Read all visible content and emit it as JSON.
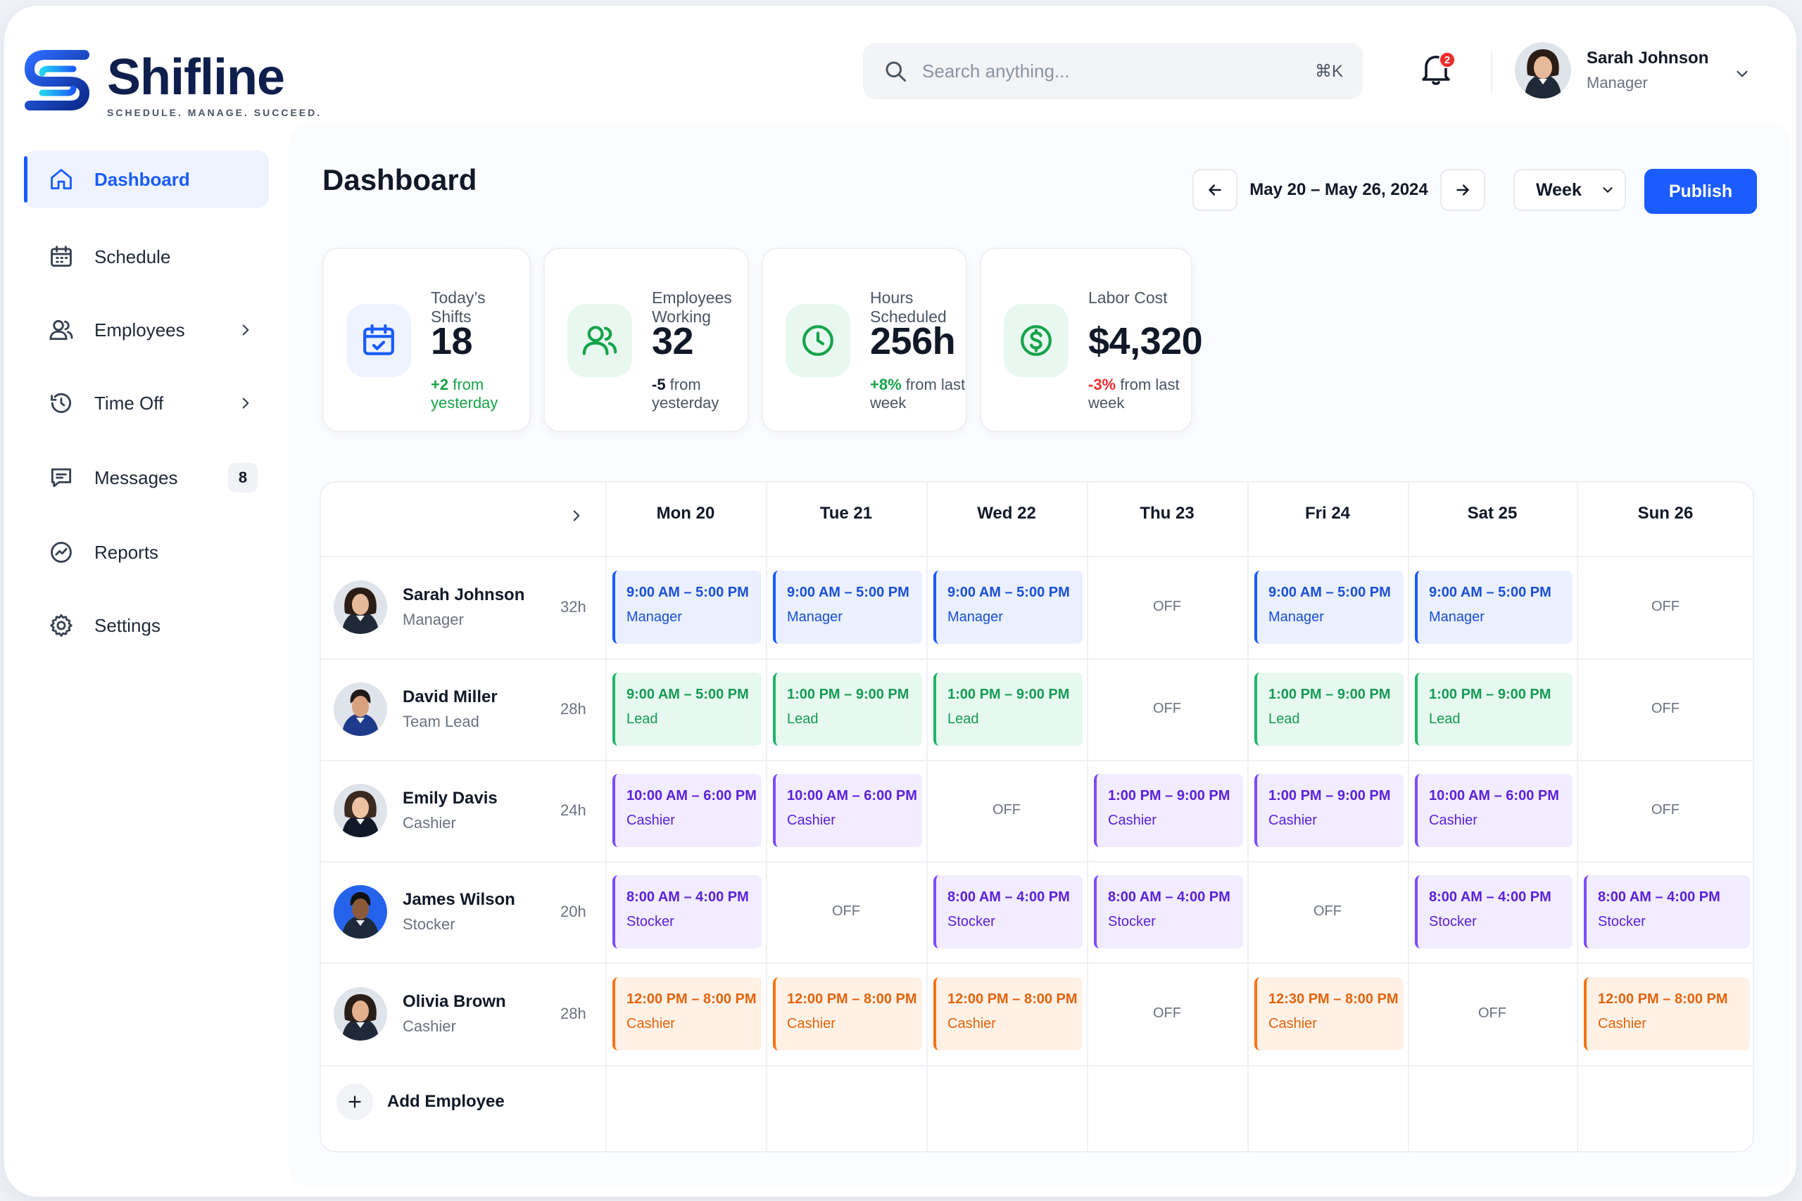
{
  "brand": {
    "name": "Shifline",
    "tagline": "SCHEDULE. MANAGE. SUCCEED."
  },
  "search": {
    "placeholder": "Search anything...",
    "shortcut": "⌘K"
  },
  "notifications": {
    "count": "2"
  },
  "user": {
    "name": "Sarah Johnson",
    "role": "Manager"
  },
  "sidebar": {
    "items": [
      {
        "label": "Dashboard",
        "icon": "home-icon",
        "active": true
      },
      {
        "label": "Schedule",
        "icon": "calendar-icon"
      },
      {
        "label": "Employees",
        "icon": "users-icon",
        "chevron": true
      },
      {
        "label": "Time Off",
        "icon": "clock-icon",
        "chevron": true
      },
      {
        "label": "Messages",
        "icon": "chat-icon",
        "badge": "8"
      },
      {
        "label": "Reports",
        "icon": "chart-icon"
      },
      {
        "label": "Settings",
        "icon": "gear-icon"
      }
    ]
  },
  "page": {
    "title": "Dashboard"
  },
  "toolbar": {
    "date_range": "May 20 – May 26, 2024",
    "view": "Week",
    "publish_label": "Publish"
  },
  "stats": [
    {
      "label": "Today’s Shifts",
      "value": "18",
      "change": "+2",
      "suffix": " from yesterday",
      "change_color": "#16a34a",
      "icon": "calendar-icon"
    },
    {
      "label": "Employees Working",
      "value": "32",
      "change": "-5",
      "suffix": " from yesterday",
      "change_color": "#111827",
      "icon": "users-icon"
    },
    {
      "label": "Hours Scheduled",
      "value": "256h",
      "change": "+8%",
      "suffix": " from last week",
      "change_color": "#16a34a",
      "icon": "clock-icon"
    },
    {
      "label": "Labor Cost",
      "value": "$4,320",
      "change": "-3%",
      "suffix": " from last week",
      "change_color": "#ef2b2b",
      "icon": "dollar-icon"
    }
  ],
  "schedule": {
    "days": [
      "Mon 20",
      "Tue 21",
      "Wed 22",
      "Thu 23",
      "Fri 24",
      "Sat 25",
      "Sun 26"
    ],
    "off_label": "OFF",
    "employees": [
      {
        "name": "Sarah Johnson",
        "role": "Manager",
        "hours": "32h",
        "shifts": [
          {
            "time": "9:00 AM – 5:00 PM",
            "role": "Manager",
            "color": "blue"
          },
          {
            "time": "9:00 AM – 5:00 PM",
            "role": "Manager",
            "color": "blue"
          },
          {
            "time": "9:00 AM – 5:00 PM",
            "role": "Manager",
            "color": "blue"
          },
          null,
          {
            "time": "9:00 AM – 5:00 PM",
            "role": "Manager",
            "color": "blue"
          },
          {
            "time": "9:00 AM – 5:00 PM",
            "role": "Manager",
            "color": "blue"
          },
          null
        ]
      },
      {
        "name": "David Miller",
        "role": "Team Lead",
        "hours": "28h",
        "shifts": [
          {
            "time": "9:00 AM – 5:00 PM",
            "role": "Lead",
            "color": "green"
          },
          {
            "time": "1:00 PM – 9:00 PM",
            "role": "Lead",
            "color": "green"
          },
          {
            "time": "1:00 PM – 9:00 PM",
            "role": "Lead",
            "color": "green"
          },
          null,
          {
            "time": "1:00 PM – 9:00 PM",
            "role": "Lead",
            "color": "green"
          },
          {
            "time": "1:00 PM – 9:00 PM",
            "role": "Lead",
            "color": "green"
          },
          null
        ]
      },
      {
        "name": "Emily Davis",
        "role": "Cashier",
        "hours": "24h",
        "shifts": [
          {
            "time": "10:00 AM – 6:00 PM",
            "role": "Cashier",
            "color": "purple"
          },
          {
            "time": "10:00 AM – 6:00 PM",
            "role": "Cashier",
            "color": "purple"
          },
          null,
          {
            "time": "1:00 PM – 9:00 PM",
            "role": "Cashier",
            "color": "purple"
          },
          {
            "time": "1:00 PM – 9:00 PM",
            "role": "Cashier",
            "color": "purple"
          },
          {
            "time": "10:00 AM – 6:00 PM",
            "role": "Cashier",
            "color": "purple"
          },
          null
        ]
      },
      {
        "name": "James Wilson",
        "role": "Stocker",
        "hours": "20h",
        "shifts": [
          {
            "time": "8:00 AM – 4:00 PM",
            "role": "Stocker",
            "color": "purple"
          },
          null,
          {
            "time": "8:00 AM – 4:00 PM",
            "role": "Stocker",
            "color": "purple"
          },
          {
            "time": "8:00 AM – 4:00 PM",
            "role": "Stocker",
            "color": "purple"
          },
          null,
          {
            "time": "8:00 AM – 4:00 PM",
            "role": "Stocker",
            "color": "purple"
          },
          {
            "time": "8:00 AM – 4:00 PM",
            "role": "Stocker",
            "color": "purple"
          }
        ]
      },
      {
        "name": "Olivia Brown",
        "role": "Cashier",
        "hours": "28h",
        "shifts": [
          {
            "time": "12:00 PM – 8:00 PM",
            "role": "Cashier",
            "color": "orange"
          },
          {
            "time": "12:00 PM – 8:00 PM",
            "role": "Cashier",
            "color": "orange"
          },
          {
            "time": "12:00 PM – 8:00 PM",
            "role": "Cashier",
            "color": "orange"
          },
          null,
          {
            "time": "12:30 PM – 8:00 PM",
            "role": "Cashier",
            "color": "orange"
          },
          null,
          {
            "time": "12:00 PM – 8:00 PM",
            "role": "Cashier",
            "color": "orange"
          }
        ]
      }
    ],
    "add_label": "Add Employee"
  },
  "colors": {
    "accent": "#1a5cff",
    "brand_navy": "#0f1f4d"
  }
}
